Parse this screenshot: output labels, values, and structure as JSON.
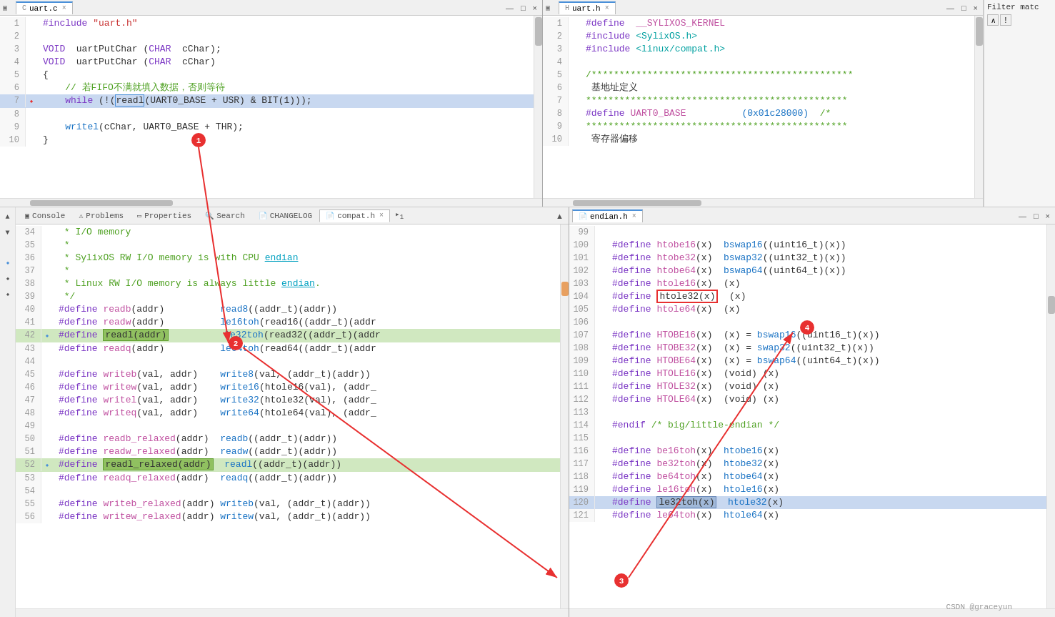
{
  "editors": {
    "top_left": {
      "tab_label": "uart.c",
      "tab_close": "×",
      "lines": [
        {
          "num": 1,
          "content": "#include \"uart.h\"",
          "class": ""
        },
        {
          "num": 2,
          "content": "",
          "class": ""
        },
        {
          "num": 3,
          "content": "VOID  uartPutChar (CHAR  cChar);",
          "class": ""
        },
        {
          "num": 4,
          "content": "VOID  uartPutChar (CHAR  cChar)",
          "class": ""
        },
        {
          "num": 5,
          "content": "{",
          "class": ""
        },
        {
          "num": 6,
          "content": "    //  若FIFO不满就填入数据，否则等待",
          "class": ""
        },
        {
          "num": 7,
          "content": "    while (!(readl(UART0_BASE + USR) & BIT(1)));",
          "class": "highlighted annotation1"
        },
        {
          "num": 8,
          "content": "",
          "class": ""
        },
        {
          "num": 9,
          "content": "    writel(cChar, UART0_BASE + THR);",
          "class": ""
        },
        {
          "num": 10,
          "content": "}",
          "class": ""
        }
      ]
    },
    "top_right": {
      "tab_label": "uart.h",
      "tab_close": "×",
      "lines": [
        {
          "num": 1,
          "content": "#define  __SYLIXOS_KERNEL",
          "class": ""
        },
        {
          "num": 2,
          "content": "#include <SylixOS.h>",
          "class": ""
        },
        {
          "num": 3,
          "content": "#include <linux/compat.h>",
          "class": ""
        },
        {
          "num": 4,
          "content": "",
          "class": ""
        },
        {
          "num": 5,
          "content": "/***********************************************",
          "class": ""
        },
        {
          "num": 6,
          "content": " 基地址定义",
          "class": ""
        },
        {
          "num": 7,
          "content": "***********************************************",
          "class": ""
        },
        {
          "num": 8,
          "content": "#define UART0_BASE          (0x01c28000)  /*",
          "class": ""
        },
        {
          "num": 9,
          "content": "***********************************************",
          "class": ""
        },
        {
          "num": 10,
          "content": " 寄存器偏移",
          "class": ""
        }
      ]
    }
  },
  "bottom_tabs": {
    "tabs": [
      {
        "label": "Console",
        "icon": "▣",
        "active": false
      },
      {
        "label": "Problems",
        "icon": "⚠",
        "active": false
      },
      {
        "label": "Properties",
        "icon": "▭",
        "active": false
      },
      {
        "label": "Search",
        "icon": "🔍",
        "active": false
      },
      {
        "label": "CHANGELOG",
        "icon": "📄",
        "active": false
      },
      {
        "label": "compat.h",
        "icon": "📄",
        "active": true
      }
    ],
    "overflow_label": "1"
  },
  "compat_lines": [
    {
      "num": 34,
      "content": " * I/O memory"
    },
    {
      "num": 35,
      "content": " *"
    },
    {
      "num": 36,
      "content": " * SylixOS RW I/O memory is with CPU endian"
    },
    {
      "num": 37,
      "content": " *"
    },
    {
      "num": 38,
      "content": " * Linux RW I/O memory is always little endian."
    },
    {
      "num": 39,
      "content": " */"
    },
    {
      "num": 40,
      "content": "#define readb(addr)          read8((addr_t)(addr))"
    },
    {
      "num": 41,
      "content": "#define readw(addr)          le16toh(read16((addr_t)(addr"
    },
    {
      "num": 42,
      "content": "#define readl(addr)          le32toh(read32((addr_t)(addr",
      "highlight": "readl(addr)"
    },
    {
      "num": 43,
      "content": "#define readq(addr)          le64toh(read64((addr_t)(addr"
    },
    {
      "num": 44,
      "content": ""
    },
    {
      "num": 45,
      "content": "#define writeb(val, addr)    write8(val, (addr_t)(addr))"
    },
    {
      "num": 46,
      "content": "#define writew(val, addr)    write16(htole16(val), (addr_"
    },
    {
      "num": 47,
      "content": "#define writel(val, addr)    write32(htole32(val), (addr_"
    },
    {
      "num": 48,
      "content": "#define writeq(val, addr)    write64(htole64(val), (addr_"
    },
    {
      "num": 49,
      "content": ""
    },
    {
      "num": 50,
      "content": "#define readb_relaxed(addr)  readb((addr_t)(addr))"
    },
    {
      "num": 51,
      "content": "#define readw_relaxed(addr)  readw((addr_t)(addr))"
    },
    {
      "num": 52,
      "content": "#define readl_relaxed(addr)  readl((addr_t)(addr))",
      "highlight": "readl_relaxed(addr)"
    },
    {
      "num": 53,
      "content": "#define readq_relaxed(addr)  readq((addr_t)(addr))"
    },
    {
      "num": 54,
      "content": ""
    },
    {
      "num": 55,
      "content": "#define writeb_relaxed(addr) writeb(val, (addr_t)(addr))"
    },
    {
      "num": 56,
      "content": "#define writew_relaxed(addr) writew(val, (addr_t)(addr))"
    }
  ],
  "endian_lines": [
    {
      "num": 99,
      "content": ""
    },
    {
      "num": 100,
      "content": "#define htobe16(x)  bswap16((uint16_t)(x))"
    },
    {
      "num": 101,
      "content": "#define htobe32(x)  bswap32((uint32_t)(x))"
    },
    {
      "num": 102,
      "content": "#define htobe64(x)  bswap64((uint64_t)(x))"
    },
    {
      "num": 103,
      "content": "#define htole16(x)  (x)"
    },
    {
      "num": 104,
      "content": "#define htole32(x)  (x)",
      "redbox": "htole32(x)"
    },
    {
      "num": 105,
      "content": "#define htole64(x)  (x)"
    },
    {
      "num": 106,
      "content": ""
    },
    {
      "num": 107,
      "content": "#define HTOBE16(x)  (x) = bswap16((uint16_t)(x))"
    },
    {
      "num": 108,
      "content": "#define HTOBE32(x)  (x) = swap32((uint32_t)(x))"
    },
    {
      "num": 109,
      "content": "#define HTOBE64(x)  (x) = bswap64((uint64_t)(x))"
    },
    {
      "num": 110,
      "content": "#define HTOLE16(x)  (void) (x)"
    },
    {
      "num": 111,
      "content": "#define HTOLE32(x)  (void) (x)"
    },
    {
      "num": 112,
      "content": "#define HTOLE64(x)  (void) (x)"
    },
    {
      "num": 113,
      "content": ""
    },
    {
      "num": 114,
      "content": "#endif /* big/little-endian */"
    },
    {
      "num": 115,
      "content": ""
    },
    {
      "num": 116,
      "content": "#define be16toh(x)  htobe16(x)"
    },
    {
      "num": 117,
      "content": "#define be32toh(x)  htobe32(x)"
    },
    {
      "num": 118,
      "content": "#define be64toh(x)  htobe64(x)"
    },
    {
      "num": 119,
      "content": "#define le16toh(x)  htole16(x)"
    },
    {
      "num": 120,
      "content": "#define le32toh(x)  htole32(x)",
      "highlight": "le32toh(x)"
    },
    {
      "num": 121,
      "content": "#define le64toh(x)  htole64(x)"
    }
  ],
  "filter": {
    "label": "Filter matc",
    "placeholder": ""
  },
  "annotations": {
    "circle1": "1",
    "circle2": "2",
    "circle3": "3",
    "circle4": "4"
  },
  "watermark": "CSDN @graceyun"
}
